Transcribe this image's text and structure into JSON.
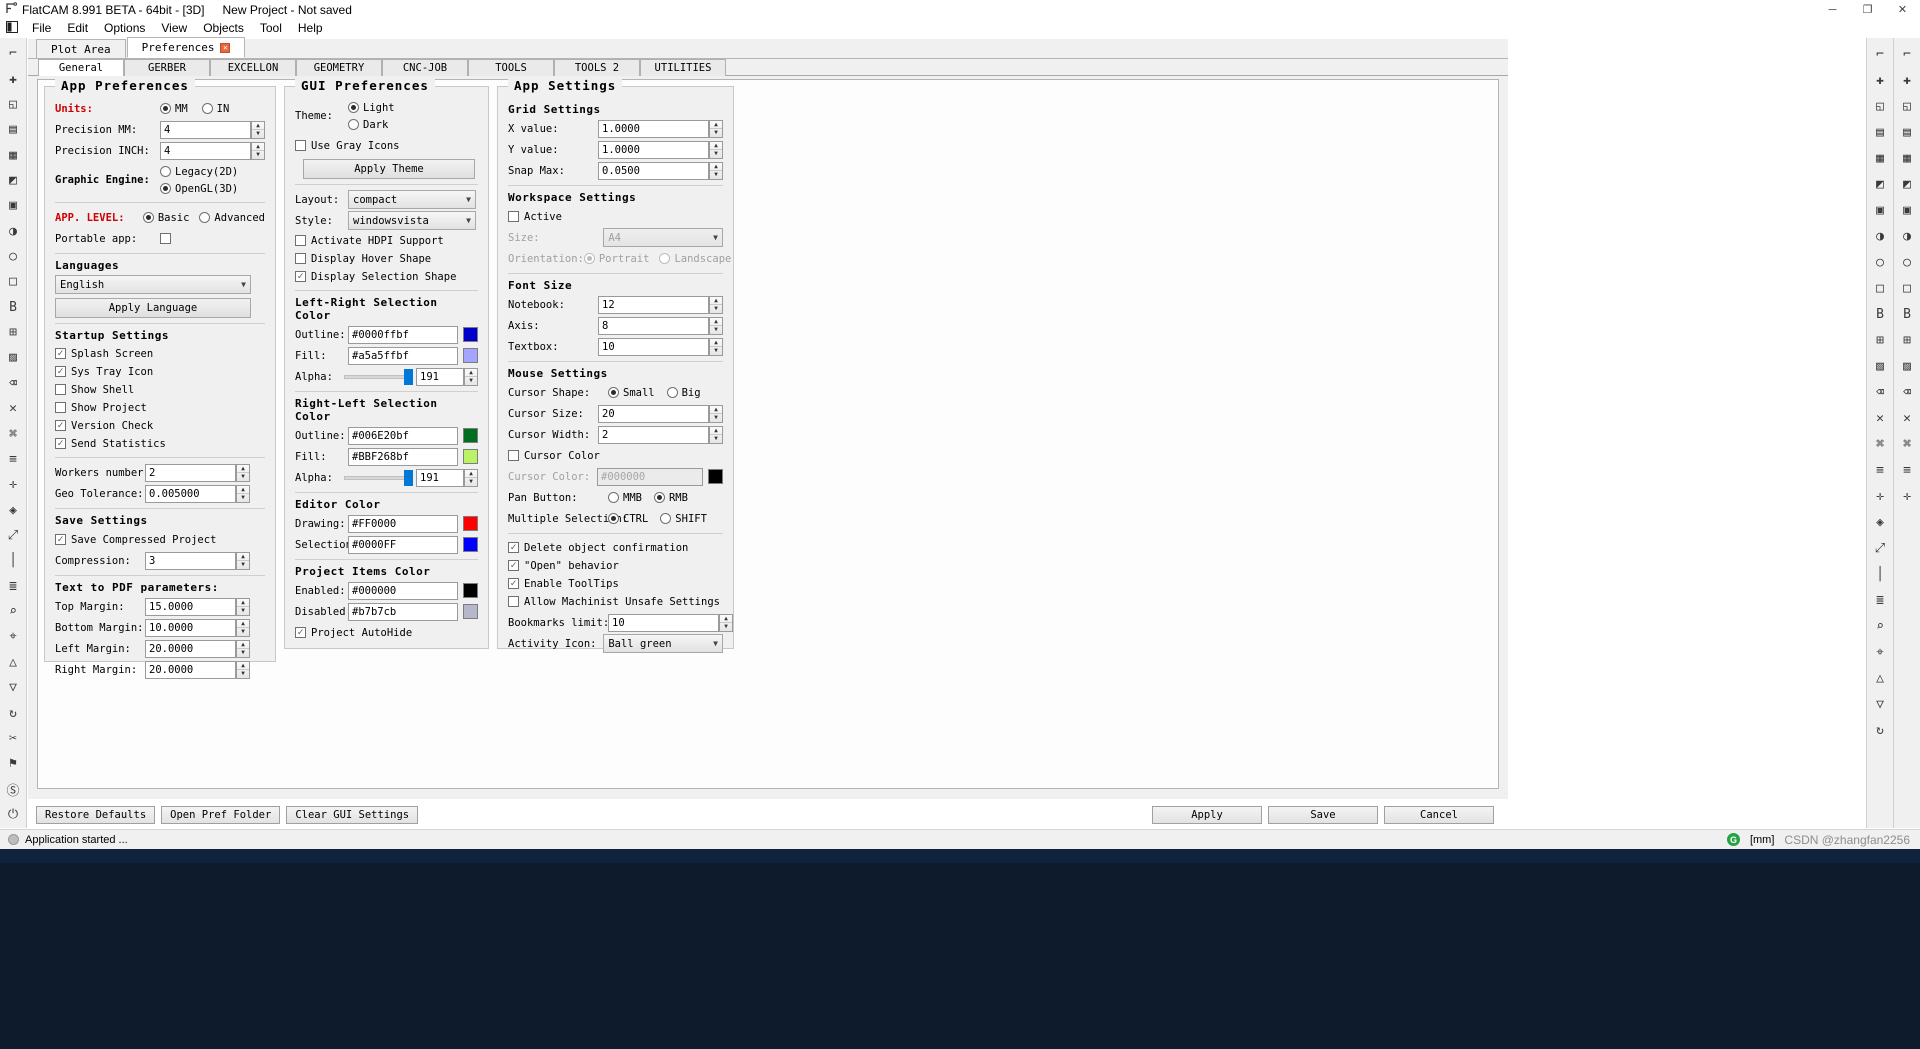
{
  "window": {
    "title": "FlatCAM 8.991 BETA - 64bit - [3D]",
    "project": "New Project - Not saved",
    "app_icon": "flatcam-icon",
    "minimize": "─",
    "maximize": "❐",
    "close": "✕"
  },
  "menu": {
    "toggle_icon": "panel-toggle-icon",
    "items": [
      "File",
      "Edit",
      "Options",
      "View",
      "Objects",
      "Tool",
      "Help"
    ]
  },
  "main_tabs": [
    {
      "label": "Plot Area",
      "active": false,
      "closable": false
    },
    {
      "label": "Preferences",
      "active": true,
      "closable": true,
      "close_glyph": "✕"
    }
  ],
  "sub_tabs": [
    {
      "label": "General",
      "active": true
    },
    {
      "label": "GERBER",
      "active": false
    },
    {
      "label": "EXCELLON",
      "active": false
    },
    {
      "label": "GEOMETRY",
      "active": false
    },
    {
      "label": "CNC-JOB",
      "active": false
    },
    {
      "label": "TOOLS",
      "active": false
    },
    {
      "label": "TOOLS 2",
      "active": false
    },
    {
      "label": "UTILITIES",
      "active": false
    }
  ],
  "app_preferences": {
    "title": "App Preferences",
    "units_label": "Units:",
    "units_options": [
      "MM",
      "IN"
    ],
    "units_selected": "MM",
    "precision_mm_label": "Precision MM:",
    "precision_mm_value": "4",
    "precision_inch_label": "Precision INCH:",
    "precision_inch_value": "4",
    "graphic_engine_label": "Graphic Engine:",
    "graphic_engine_options": [
      "Legacy(2D)",
      "OpenGL(3D)"
    ],
    "graphic_engine_selected": "OpenGL(3D)",
    "app_level_label": "APP. LEVEL:",
    "app_level_options": [
      "Basic",
      "Advanced"
    ],
    "app_level_selected": "Basic",
    "portable_label": "Portable app:",
    "portable_checked": false,
    "languages_title": "Languages",
    "language_value": "English",
    "apply_language_label": "Apply Language",
    "startup_title": "Startup Settings",
    "startup_items": [
      {
        "label": "Splash Screen",
        "checked": true
      },
      {
        "label": "Sys Tray Icon",
        "checked": true
      },
      {
        "label": "Show Shell",
        "checked": false
      },
      {
        "label": "Show Project",
        "checked": false
      },
      {
        "label": "Version Check",
        "checked": true
      },
      {
        "label": "Send Statistics",
        "checked": true
      }
    ],
    "workers_label": "Workers number:",
    "workers_value": "2",
    "geo_tolerance_label": "Geo Tolerance:",
    "geo_tolerance_value": "0.005000",
    "save_title": "Save Settings",
    "save_compressed_label": "Save Compressed Project",
    "save_compressed_checked": true,
    "compression_label": "Compression:",
    "compression_value": "3",
    "pdf_title": "Text to PDF parameters:",
    "pdf_rows": [
      {
        "label": "Top Margin:",
        "value": "15.0000"
      },
      {
        "label": "Bottom Margin:",
        "value": "10.0000"
      },
      {
        "label": "Left Margin:",
        "value": "20.0000"
      },
      {
        "label": "Right Margin:",
        "value": "20.0000"
      }
    ]
  },
  "gui_preferences": {
    "title": "GUI Preferences",
    "theme_label": "Theme:",
    "theme_options": [
      "Light",
      "Dark"
    ],
    "theme_selected": "Light",
    "gray_icons_label": "Use Gray Icons",
    "gray_icons_checked": false,
    "apply_theme_label": "Apply Theme",
    "layout_label": "Layout:",
    "layout_value": "compact",
    "style_label": "Style:",
    "style_value": "windowsvista",
    "checks": [
      {
        "label": "Activate HDPI Support",
        "checked": false
      },
      {
        "label": "Display Hover Shape",
        "checked": false
      },
      {
        "label": "Display Selection Shape",
        "checked": true
      }
    ],
    "lr_title": "Left-Right Selection Color",
    "lr_outline_label": "Outline:",
    "lr_outline_value": "#0000ffbf",
    "lr_outline_swatch": "#0000cc",
    "lr_fill_label": "Fill:",
    "lr_fill_value": "#a5a5ffbf",
    "lr_fill_swatch": "#a5a5ff",
    "lr_alpha_label": "Alpha:",
    "lr_alpha_value": "191",
    "rl_title": "Right-Left Selection Color",
    "rl_outline_label": "Outline:",
    "rl_outline_value": "#006E20bf",
    "rl_outline_swatch": "#006E20",
    "rl_fill_label": "Fill:",
    "rl_fill_value": "#BBF268bf",
    "rl_fill_swatch": "#BBF268",
    "rl_alpha_label": "Alpha:",
    "rl_alpha_value": "191",
    "editor_title": "Editor Color",
    "editor_drawing_label": "Drawing:",
    "editor_drawing_value": "#FF0000",
    "editor_drawing_swatch": "#FF0000",
    "editor_selection_label": "Selection:",
    "editor_selection_value": "#0000FF",
    "editor_selection_swatch": "#0000FF",
    "project_title": "Project Items Color",
    "project_enabled_label": "Enabled:",
    "project_enabled_value": "#000000",
    "project_enabled_swatch": "#000000",
    "project_disabled_label": "Disabled:",
    "project_disabled_value": "#b7b7cb",
    "project_disabled_swatch": "#b7b7cb",
    "project_autohide_label": "Project AutoHide",
    "project_autohide_checked": true
  },
  "app_settings": {
    "title": "App Settings",
    "grid_title": "Grid Settings",
    "grid_rows": [
      {
        "label": "X value:",
        "value": "1.0000"
      },
      {
        "label": "Y value:",
        "value": "1.0000"
      },
      {
        "label": "Snap Max:",
        "value": "0.0500"
      }
    ],
    "workspace_title": "Workspace Settings",
    "workspace_active_label": "Active",
    "workspace_active_checked": false,
    "workspace_size_label": "Size:",
    "workspace_size_value": "A4",
    "orientation_label": "Orientation:",
    "orientation_options": [
      "Portrait",
      "Landscape"
    ],
    "orientation_selected": "Portrait",
    "font_title": "Font Size",
    "font_rows": [
      {
        "label": "Notebook:",
        "value": "12"
      },
      {
        "label": "Axis:",
        "value": "8"
      },
      {
        "label": "Textbox:",
        "value": "10"
      }
    ],
    "mouse_title": "Mouse Settings",
    "cursor_shape_label": "Cursor Shape:",
    "cursor_shape_options": [
      "Small",
      "Big"
    ],
    "cursor_shape_selected": "Small",
    "cursor_size_label": "Cursor Size:",
    "cursor_size_value": "20",
    "cursor_width_label": "Cursor Width:",
    "cursor_width_value": "2",
    "cursor_color_check_label": "Cursor Color",
    "cursor_color_checked": false,
    "cursor_color_label": "Cursor Color:",
    "cursor_color_value": "#000000",
    "cursor_color_swatch": "#000000",
    "pan_button_label": "Pan Button:",
    "pan_button_options": [
      "MMB",
      "RMB"
    ],
    "pan_button_selected": "RMB",
    "multiple_selection_label": "Multiple Selection:",
    "multiple_selection_options": [
      "CTRL",
      "SHIFT"
    ],
    "multiple_selection_selected": "CTRL",
    "bottom_checks": [
      {
        "label": "Delete object confirmation",
        "checked": true
      },
      {
        "label": "\"Open\" behavior",
        "checked": true
      },
      {
        "label": "Enable ToolTips",
        "checked": true
      },
      {
        "label": "Allow Machinist Unsafe Settings",
        "checked": false
      }
    ],
    "bookmarks_label": "Bookmarks limit:",
    "bookmarks_value": "10",
    "activity_label": "Activity Icon:",
    "activity_value": "Ball green"
  },
  "bottom_buttons": {
    "left": [
      "Restore Defaults",
      "Open Pref Folder",
      "Clear GUI Settings"
    ],
    "right": [
      "Apply",
      "Save",
      "Cancel"
    ]
  },
  "statusbar": {
    "message": "Application started ...",
    "green_badge": "G",
    "units": "[mm]",
    "watermark": "CSDN @zhangfan2256"
  },
  "left_toolbar_icons": [
    "open-project-icon",
    "new-geometry-icon",
    "new-excellon-icon",
    "folder-icon",
    "save-icon",
    "gerber-editor-icon",
    "excellon-editor-icon",
    "geometry-editor-icon",
    "properties-icon",
    "copy-icon",
    "notes-icon",
    "measure-icon",
    "distance-icon",
    "origin-icon",
    "jump-icon",
    "replace-icon",
    "code-icon",
    "grid-icon",
    "brackets-icon",
    "transform-icon",
    "cut-icon",
    "nonc-icon",
    "pen-icon",
    "panel-icon",
    "book-icon",
    "flag-icon",
    "s-icon",
    "calc-icon",
    "crop-icon",
    "chevron-down-icon",
    "power-icon"
  ],
  "right_toolbar_a_icons": [
    "cursor-icon",
    "plus-cross-icon",
    "zoom-fit-icon",
    "copy-shape-icon",
    "grid-snap-icon",
    "layer-icon",
    "shape-icon",
    "moon-icon",
    "circle-icon",
    "square-icon",
    "b-icon",
    "grid-icon",
    "table-icon",
    "eraser-icon",
    "delete-icon",
    "transform-icon",
    "align-icon",
    "move-icon",
    "select-icon",
    "cross-icon",
    "plus-icon",
    "apps-icon",
    "expand-icon",
    "ruler-icon",
    "bars-icon",
    "zoom-in-icon",
    "zoom-out-icon"
  ],
  "right_toolbar_b_icons": [
    "select-arrow-icon",
    "circle-outline-icon",
    "rect-outline-icon",
    "polyline-icon",
    "path-icon",
    "text-icon",
    "bold-icon",
    "shape2-icon",
    "grid2-icon",
    "union-icon",
    "intersect-icon",
    "close2-icon",
    "crop2-icon",
    "x-icon",
    "resize-icon",
    "bars2-icon",
    "magnifier-icon",
    "search-icon"
  ]
}
